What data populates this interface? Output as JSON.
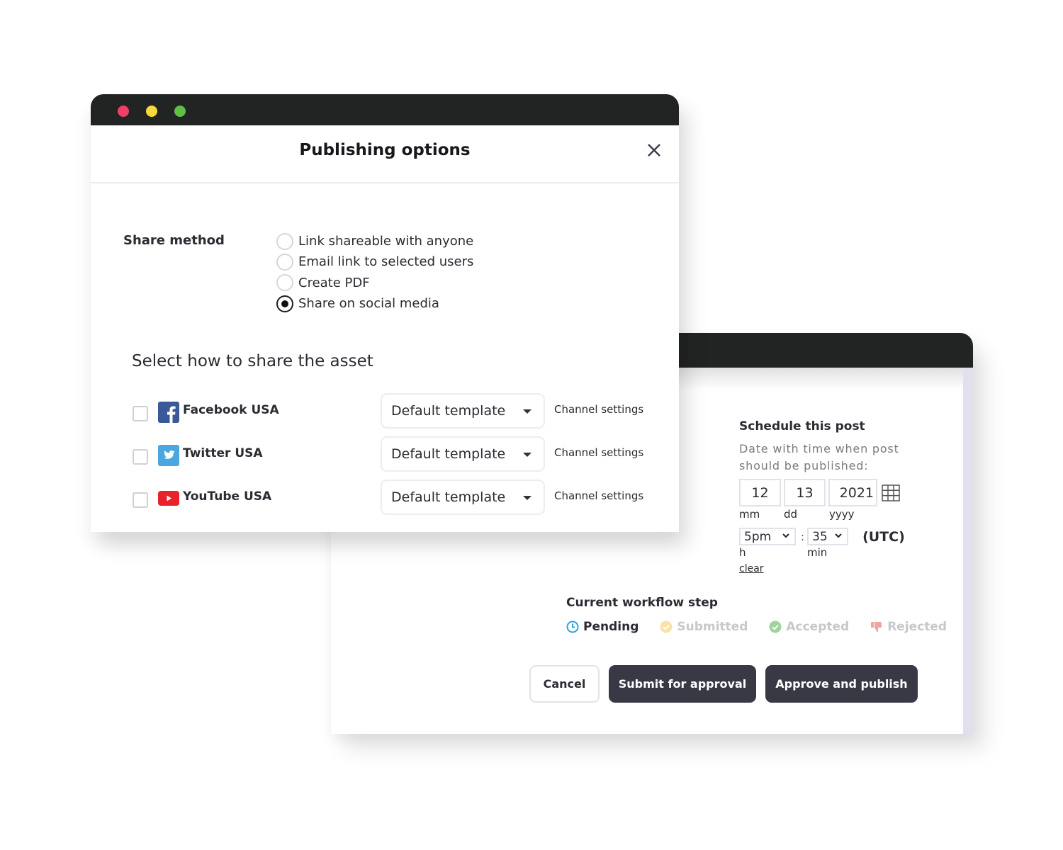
{
  "front_window": {
    "title": "Publishing options",
    "close_icon": "close-icon",
    "window_controls": [
      "close-dot",
      "minimize-dot",
      "maximize-dot"
    ],
    "share_method": {
      "label": "Share method",
      "options": [
        {
          "label": "Link shareable with anyone",
          "selected": false
        },
        {
          "label": "Email link to selected users",
          "selected": false
        },
        {
          "label": "Create PDF",
          "selected": false
        },
        {
          "label": "Share on social media",
          "selected": true
        }
      ]
    },
    "share_section_title": "Select how to share the asset",
    "channels": [
      {
        "name": "Facebook USA",
        "icon": "facebook-icon",
        "checked": false,
        "template": "Default template",
        "settings_label": "Channel settings",
        "color": "#3b5998"
      },
      {
        "name": "Twitter USA",
        "icon": "twitter-icon",
        "checked": false,
        "template": "Default template",
        "settings_label": "Channel settings",
        "color": "#4aa7df"
      },
      {
        "name": "YouTube USA",
        "icon": "youtube-icon",
        "checked": false,
        "template": "Default template",
        "settings_label": "Channel settings",
        "color": "#e8212a"
      }
    ]
  },
  "back_window": {
    "schedule": {
      "title": "Schedule this post",
      "description": "Date with time when post should be published:",
      "month": "12",
      "day": "13",
      "year": "2021",
      "month_label": "mm",
      "day_label": "dd",
      "year_label": "yyyy",
      "hour": "5pm",
      "minute": "35",
      "separator": ":",
      "timezone": "(UTC)",
      "hour_label": "h",
      "minute_label": "min",
      "clear_label": "clear",
      "calendar_icon": "calendar-grid-icon"
    },
    "workflow": {
      "title": "Current workflow step",
      "steps": [
        {
          "label": "Pending",
          "icon": "clock-icon",
          "active": true,
          "color": "#2aa4e0"
        },
        {
          "label": "Submitted",
          "icon": "check-circle-icon",
          "active": false,
          "color": "#fbe3a6"
        },
        {
          "label": "Accepted",
          "icon": "check-circle-icon",
          "active": false,
          "color": "#9fd49c"
        },
        {
          "label": "Rejected",
          "icon": "thumbs-down-icon",
          "active": false,
          "color": "#f4a3a3"
        }
      ]
    },
    "buttons": {
      "cancel": "Cancel",
      "submit": "Submit for approval",
      "approve": "Approve and publish"
    }
  },
  "colors": {
    "titlebar": "#222423",
    "dark_button": "#383945",
    "dot_red": "#ee3f66",
    "dot_yellow": "#f7d93c",
    "dot_green": "#5fbe46"
  }
}
